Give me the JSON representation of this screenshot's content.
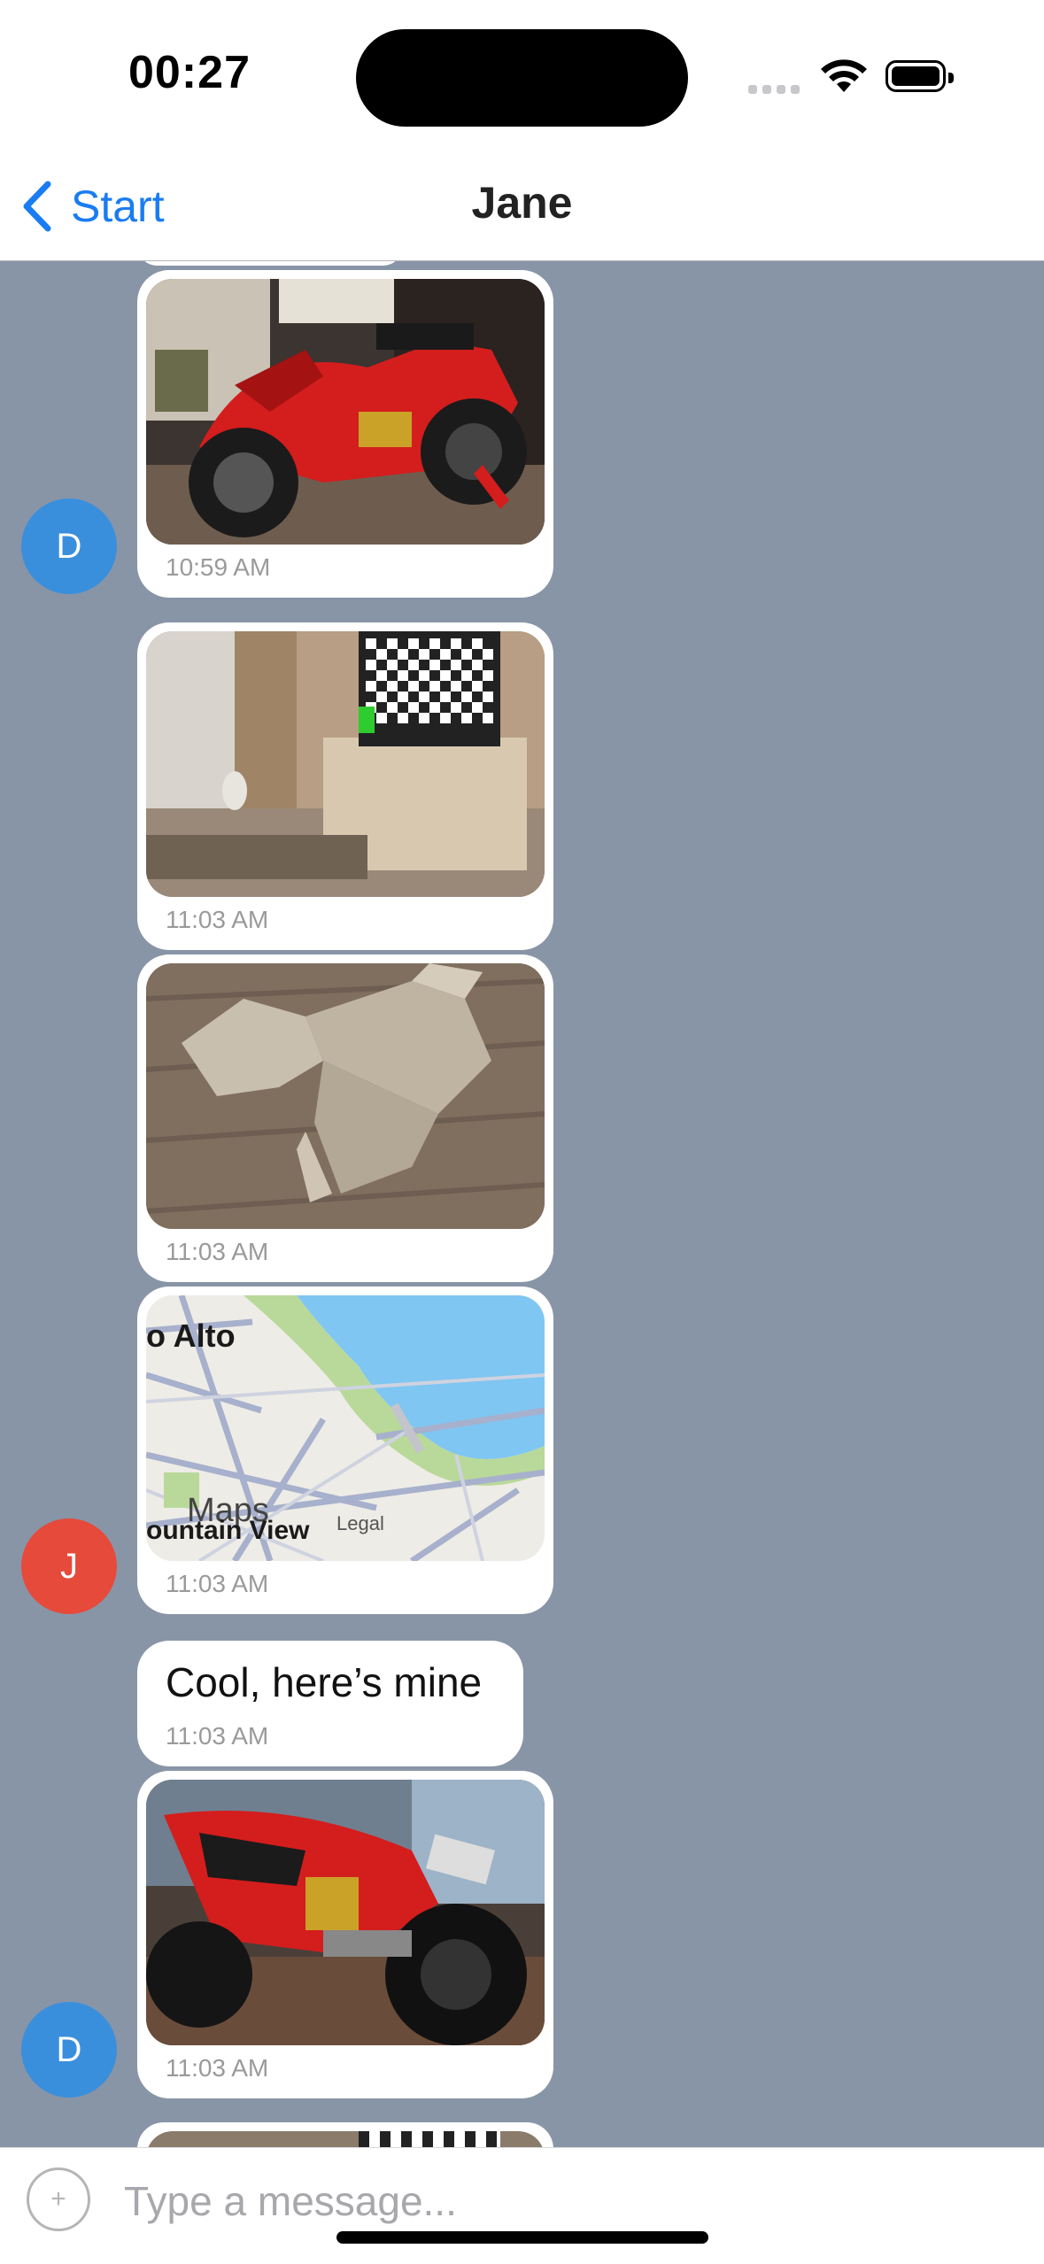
{
  "status": {
    "time": "00:27"
  },
  "nav": {
    "back_label": "Start",
    "title": "Jane"
  },
  "messages": [
    {
      "type": "image",
      "subject": "red motorcycle on stand",
      "time": "10:59 AM"
    },
    {
      "type": "image",
      "subject": "living room with checkerboard TV",
      "time": "11:03 AM"
    },
    {
      "type": "image",
      "subject": "low-poly dog model",
      "time": "11:03 AM"
    },
    {
      "type": "map",
      "labels": [
        "o Alto",
        "Maps",
        "ountain View",
        "Legal"
      ],
      "time": "11:03 AM"
    },
    {
      "type": "text",
      "text": "Cool, here’s mine",
      "time": "11:03 AM"
    },
    {
      "type": "image",
      "subject": "red motorcycle rear view",
      "time": "11:03 AM"
    }
  ],
  "avatars": [
    {
      "initial": "D",
      "color": "#3a8fdc"
    },
    {
      "initial": "J",
      "color": "#e64a3b"
    },
    {
      "initial": "D",
      "color": "#3a8fdc"
    }
  ],
  "input": {
    "placeholder": "Type a message..."
  },
  "colors": {
    "accent": "#1a7cf2",
    "chat_bg": "#8895a7"
  }
}
